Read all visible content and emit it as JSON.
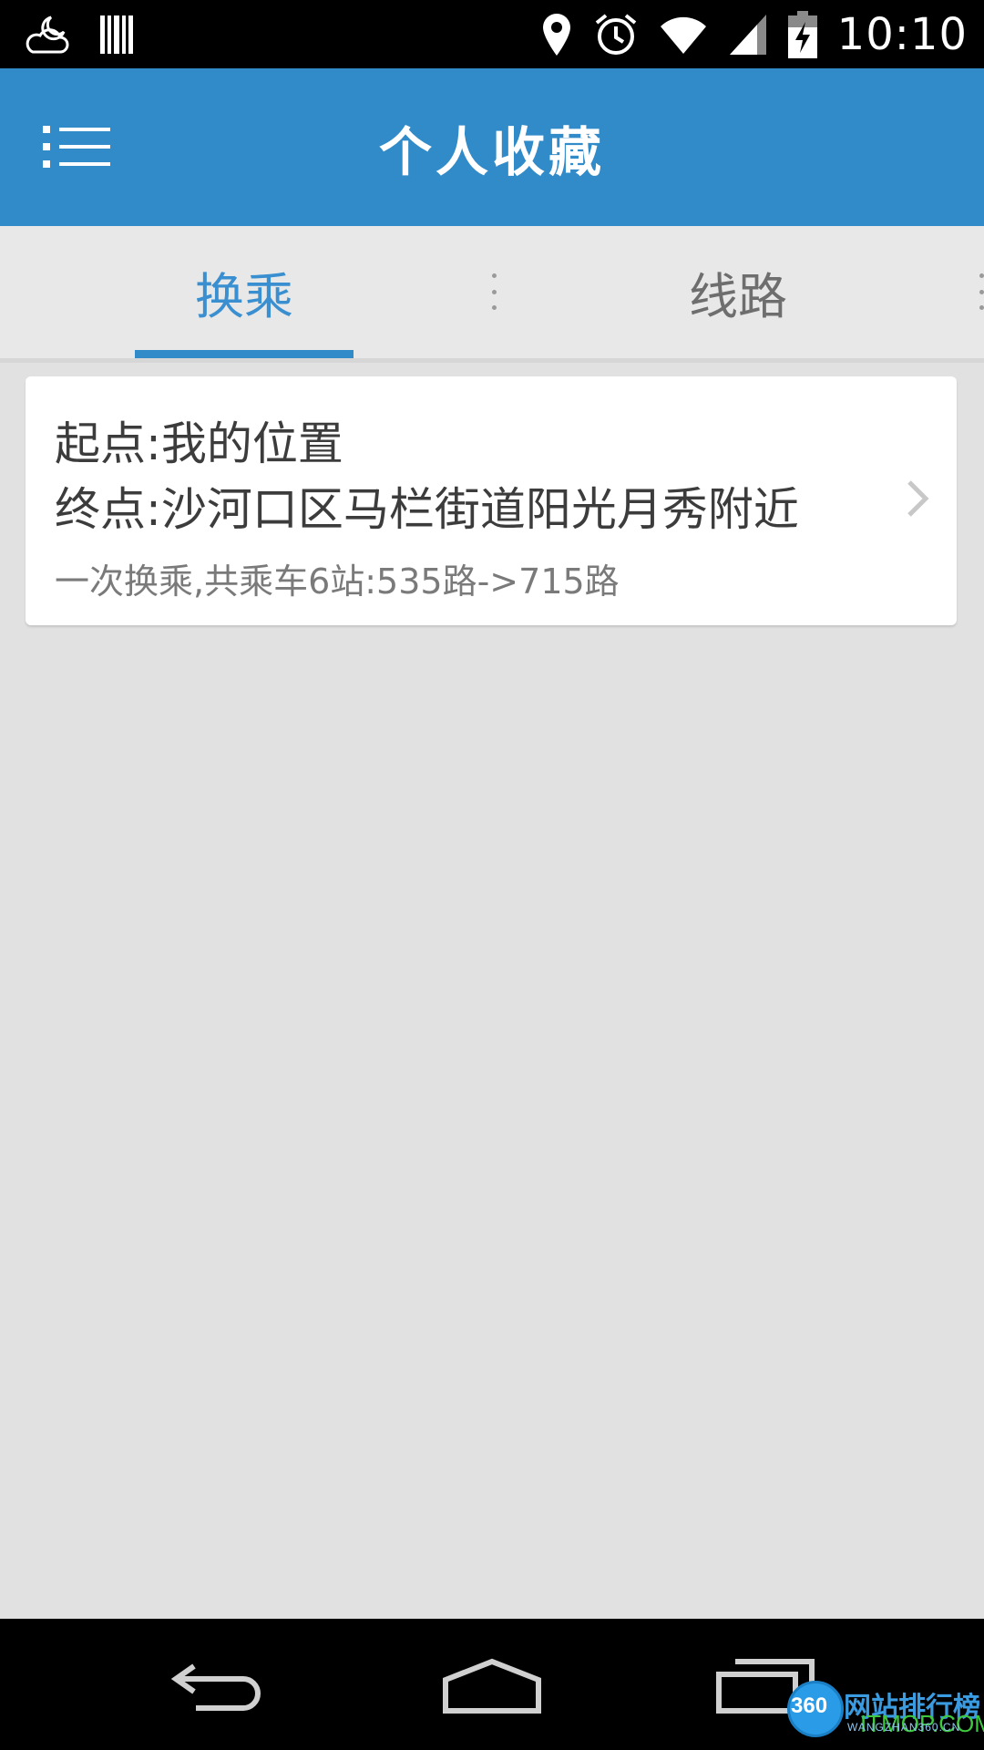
{
  "status_bar": {
    "time": "10:10",
    "icons": [
      "weather-cloudy-night-icon",
      "barcode-icon",
      "location-pin-icon",
      "alarm-icon",
      "wifi-icon",
      "signal-icon",
      "battery-charging-icon"
    ]
  },
  "app_bar": {
    "title": "个人收藏",
    "menu_icon": "menu-list-icon"
  },
  "tabs": [
    {
      "label": "换乘",
      "selected": true
    },
    {
      "label": "线路",
      "selected": false
    }
  ],
  "favorites": [
    {
      "start": "起点:我的位置",
      "end": "终点:沙河口区马栏街道阳光月秀附近",
      "summary": "一次换乘,共乘车6站:535路->715路"
    }
  ],
  "nav_bar": {
    "icons": [
      "back-icon",
      "home-icon",
      "recent-apps-icon"
    ]
  },
  "watermark": {
    "badge": "360",
    "title": "网站排行榜",
    "subtitle": "WANGZHAN360.CN",
    "overlay": "ITMOP.COM"
  },
  "colors": {
    "primary": "#318bc8",
    "tab_selected": "#3a8fd0",
    "tab_unselected": "#6e6e6e",
    "background": "#e1e1e1"
  }
}
